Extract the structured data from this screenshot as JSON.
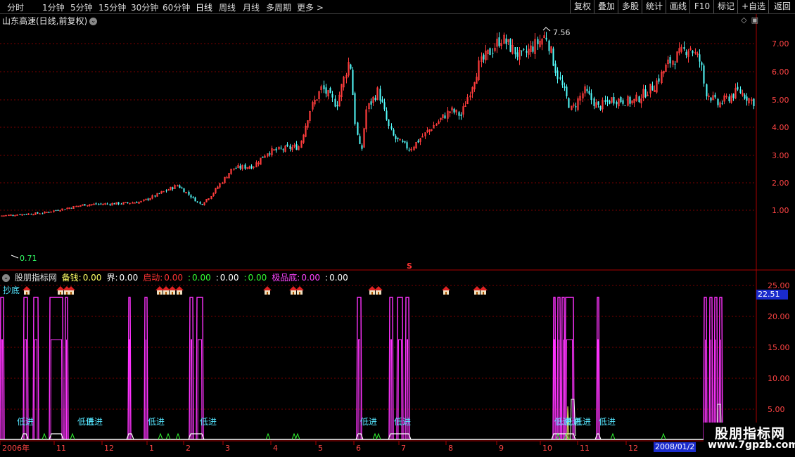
{
  "toolbar": {
    "timeframes": [
      "分时",
      "1分钟",
      "5分钟",
      "15分钟",
      "30分钟",
      "60分钟",
      "日线",
      "周线",
      "月线",
      "多周期",
      "更多 >"
    ],
    "active_timeframe": "日线",
    "right_buttons": [
      "复权",
      "叠加",
      "多股",
      "统计",
      "画线",
      "F10",
      "标记",
      "+自选",
      "返回"
    ]
  },
  "price_panel": {
    "title": "山东高速(日线,前复权)",
    "y_ticks": [
      "7.00",
      "6.00",
      "5.00",
      "4.00",
      "3.00",
      "2.00",
      "1.00"
    ],
    "high_label": "7.56",
    "low_label": "0.71",
    "marker": "S"
  },
  "indicator_panel": {
    "name": "股朋指标网",
    "fields": [
      {
        "label": "备钱:",
        "value": "0.00",
        "label_color": "#ffff66",
        "value_color": "#ffff66"
      },
      {
        "label": "界:",
        "value": "0.00",
        "label_color": "#ffffff",
        "value_color": "#ffffff"
      },
      {
        "label": "启动:",
        "value": "0.00",
        "label_color": "#ff3333",
        "value_color": "#ff3333"
      },
      {
        "label": ":",
        "value": "0.00",
        "label_color": "#33ff33",
        "value_color": "#33ff33"
      },
      {
        "label": ":",
        "value": "0.00",
        "label_color": "#ffffff",
        "value_color": "#ffffff"
      },
      {
        "label": ":",
        "value": "0.00",
        "label_color": "#33ff33",
        "value_color": "#33ff33"
      },
      {
        "label": "极品底:",
        "value": "0.00",
        "label_color": "#ff44ff",
        "value_color": "#ff44ff"
      },
      {
        "label": ":",
        "value": "0.00",
        "label_color": "#ffffff",
        "value_color": "#ffffff"
      }
    ],
    "corner_label": "抄底",
    "y_ticks": [
      "25.00",
      "20.00",
      "15.00",
      "10.00",
      "5.00"
    ],
    "highlight_value": "22.51",
    "signal_labels": [
      "低进",
      "低进",
      "低进",
      "低进",
      "低进",
      "低进",
      "低进",
      "低进",
      "低进",
      "低进",
      "低进"
    ]
  },
  "x_axis": {
    "labels": [
      "2006年",
      "11",
      "12",
      "1",
      "2",
      "3",
      "4",
      "5",
      "6",
      "7",
      "8",
      "9",
      "10",
      "11",
      "12"
    ],
    "highlight_date": "2008/01/2"
  },
  "watermark": {
    "title": "股朋指标网",
    "url": "www.7gpzb.com"
  },
  "colors": {
    "up": "#ff3c3c",
    "down": "#54ffff",
    "grid": "#7a0000",
    "axis": "#aa0000",
    "signal": "#ff33ff"
  },
  "chart_data": {
    "type": "candlestick",
    "y_range": [
      0.5,
      7.8
    ],
    "key_points": [
      {
        "date": "2006年",
        "close": 0.8
      },
      {
        "date": "11",
        "close": 1.05
      },
      {
        "date": "12",
        "close": 1.25
      },
      {
        "date": "1",
        "close": 1.9
      },
      {
        "date": "2",
        "close": 1.15
      },
      {
        "date": "3",
        "close": 2.6
      },
      {
        "date": "4",
        "close": 3.05
      },
      {
        "date": "5",
        "close": 5.7
      },
      {
        "date": "6",
        "close": 3.3
      },
      {
        "date": "7",
        "close": 4.4
      },
      {
        "date": "8",
        "close": 4.3
      },
      {
        "date": "9",
        "close": 7.2
      },
      {
        "date": "10",
        "close": 6.3
      },
      {
        "date": "11",
        "close": 4.6
      },
      {
        "date": "12",
        "close": 6.5
      },
      {
        "date": "2008/01",
        "close": 4.9
      }
    ],
    "high": 7.56,
    "low": 0.71
  }
}
